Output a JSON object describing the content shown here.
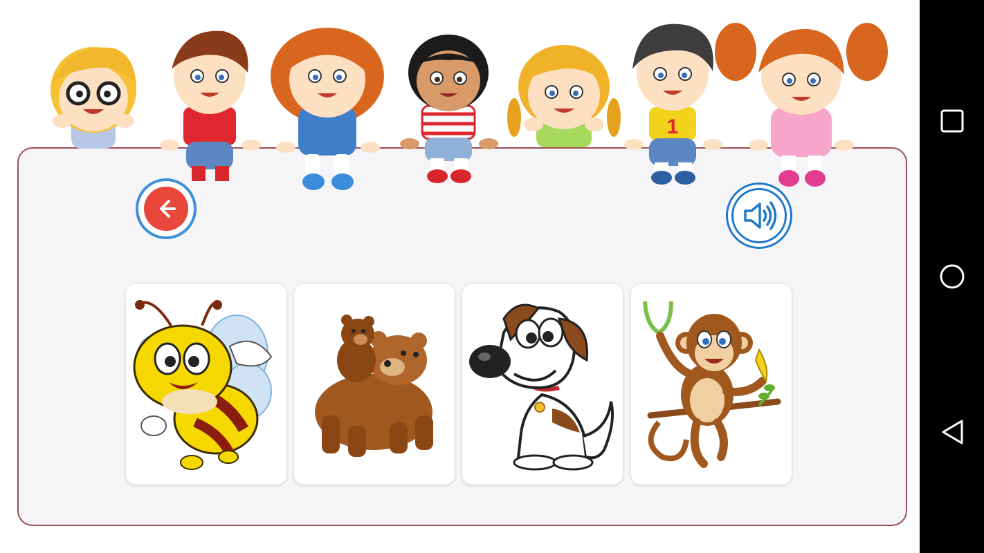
{
  "header": {
    "kids_banner_icon": "children-sitting-banner",
    "back_icon": "arrow-left-icon",
    "sound_icon": "speaker-icon"
  },
  "cards": [
    {
      "animal": "bee",
      "icon": "bee-icon"
    },
    {
      "animal": "bear",
      "icon": "bear-icon"
    },
    {
      "animal": "dog",
      "icon": "dog-icon"
    },
    {
      "animal": "monkey",
      "icon": "monkey-icon"
    }
  ],
  "colors": {
    "board_border": "#9c4f55",
    "board_fill": "#f5f5f7",
    "back_button": "#e8473c",
    "accent_blue": "#1f78c8"
  },
  "system_nav": {
    "recents_icon": "square-icon",
    "home_icon": "circle-icon",
    "back_icon": "triangle-back-icon"
  }
}
